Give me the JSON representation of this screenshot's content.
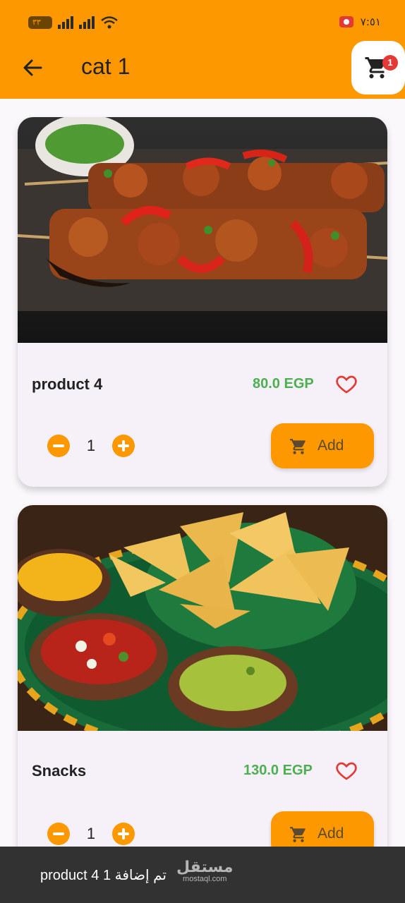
{
  "status_bar": {
    "battery": "٣٣",
    "time": "٧:٥١"
  },
  "app_bar": {
    "title": "cat 1",
    "cart_count": "1"
  },
  "products": [
    {
      "name": "product 4",
      "price": "80.0 EGP",
      "quantity": "1",
      "add_label": "Add",
      "image": "chicken-skewers-photo"
    },
    {
      "name": "Snacks",
      "price": "130.0 EGP",
      "quantity": "1",
      "add_label": "Add",
      "image": "nachos-dips-photo"
    }
  ],
  "snackbar": {
    "message": "تم إضافة 1 product 4"
  },
  "watermark": {
    "arabic": "مستقل",
    "latin": "mostaql.com"
  },
  "colors": {
    "primary": "#fe9800",
    "price": "#4caf50",
    "favorite": "#e53935",
    "badge": "#e53935"
  },
  "icons": [
    "arrow-back-icon",
    "cart-icon",
    "heart-outline-icon",
    "minus-icon",
    "plus-icon",
    "add-cart-icon",
    "wifi-icon",
    "signal-icon",
    "battery-icon",
    "screen-record-icon"
  ]
}
